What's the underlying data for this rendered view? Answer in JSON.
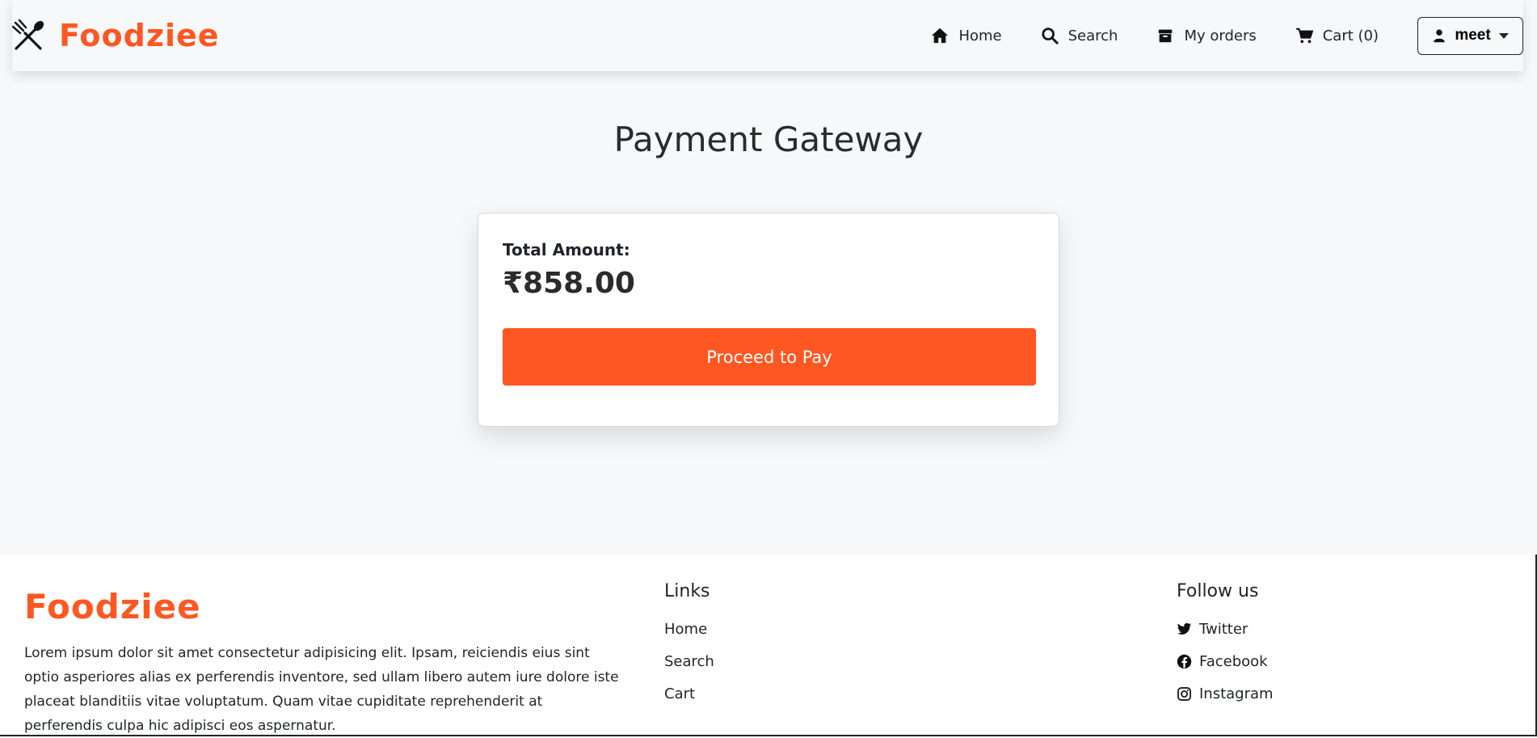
{
  "navbar": {
    "brand": "Foodziee",
    "items": [
      {
        "label": "Home",
        "icon": "home-icon"
      },
      {
        "label": "Search",
        "icon": "search-icon"
      },
      {
        "label": "My orders",
        "icon": "box-icon"
      },
      {
        "label": "Cart (0)",
        "icon": "cart-icon"
      }
    ],
    "user": "meet"
  },
  "main": {
    "title": "Payment Gateway",
    "total_label": "Total Amount:",
    "total_amount": "₹858.00",
    "pay_button": "Proceed to Pay"
  },
  "footer": {
    "brand": "Foodziee",
    "description": "Lorem ipsum dolor sit amet consectetur adipisicing elit. Ipsam, reiciendis eius sint optio asperiores alias ex perferendis inventore, sed ullam libero autem iure dolore iste placeat blanditiis vitae voluptatum. Quam vitae cupiditate reprehenderit at perferendis culpa hic adipisci eos aspernatur.",
    "links_title": "Links",
    "links": [
      "Home",
      "Search",
      "Cart"
    ],
    "follow_title": "Follow us",
    "social": [
      {
        "label": "Twitter",
        "icon": "twitter-icon"
      },
      {
        "label": "Facebook",
        "icon": "facebook-icon"
      },
      {
        "label": "Instagram",
        "icon": "instagram-icon"
      }
    ]
  },
  "colors": {
    "accent": "#ff5722",
    "background": "#f7f8fa",
    "text": "#212529"
  }
}
